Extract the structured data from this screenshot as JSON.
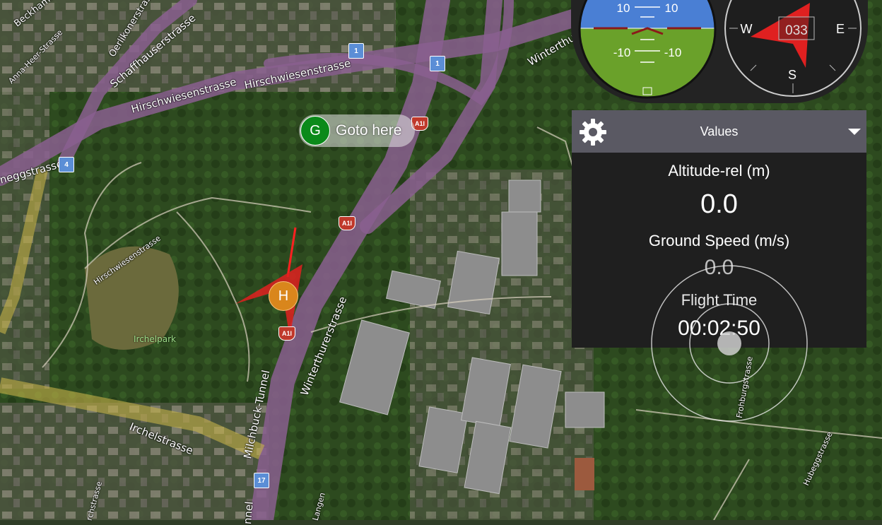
{
  "map": {
    "street_labels": [
      "Beckhammer",
      "Oerlikonerstrasse",
      "Schaffhauserstrasse",
      "Anna-Heer-Strasse",
      "Hirschwiesenstrasse",
      "Hirschwiesenstrasse",
      "Winterthurerstrasse",
      "neggstrasse",
      "Hirschwiesenstrasse",
      "Irchelpark",
      "Winterthurerstrasse",
      "Milchbuck-Tunnel",
      "Irchelstrasse",
      "Frohburgstrasse",
      "Hubeggstrasse",
      "Langen",
      "rchstrasse",
      "nnel"
    ],
    "route_shields": [
      "1",
      "1",
      "4",
      "17"
    ],
    "highway_shields": [
      "A1l",
      "A1l",
      "A1l"
    ]
  },
  "goto": {
    "badge": "G",
    "label": "Goto here"
  },
  "home_marker": {
    "badge": "H"
  },
  "attitude": {
    "top_left": "10",
    "top_right": "10",
    "bottom_left": "-10",
    "bottom_right": "-10",
    "sky_color": "#4a7fd4",
    "ground_color": "#6aa12a"
  },
  "compass": {
    "heading": "033",
    "west": "W",
    "east": "E",
    "south": "S",
    "needle_color": "#e02020"
  },
  "values_panel": {
    "title": "Values",
    "items": [
      {
        "label": "Altitude-rel (m)",
        "value": "0.0"
      },
      {
        "label": "Ground Speed (m/s)",
        "value": "0.0"
      },
      {
        "label": "Flight Time",
        "value": "00:02:50"
      }
    ]
  }
}
